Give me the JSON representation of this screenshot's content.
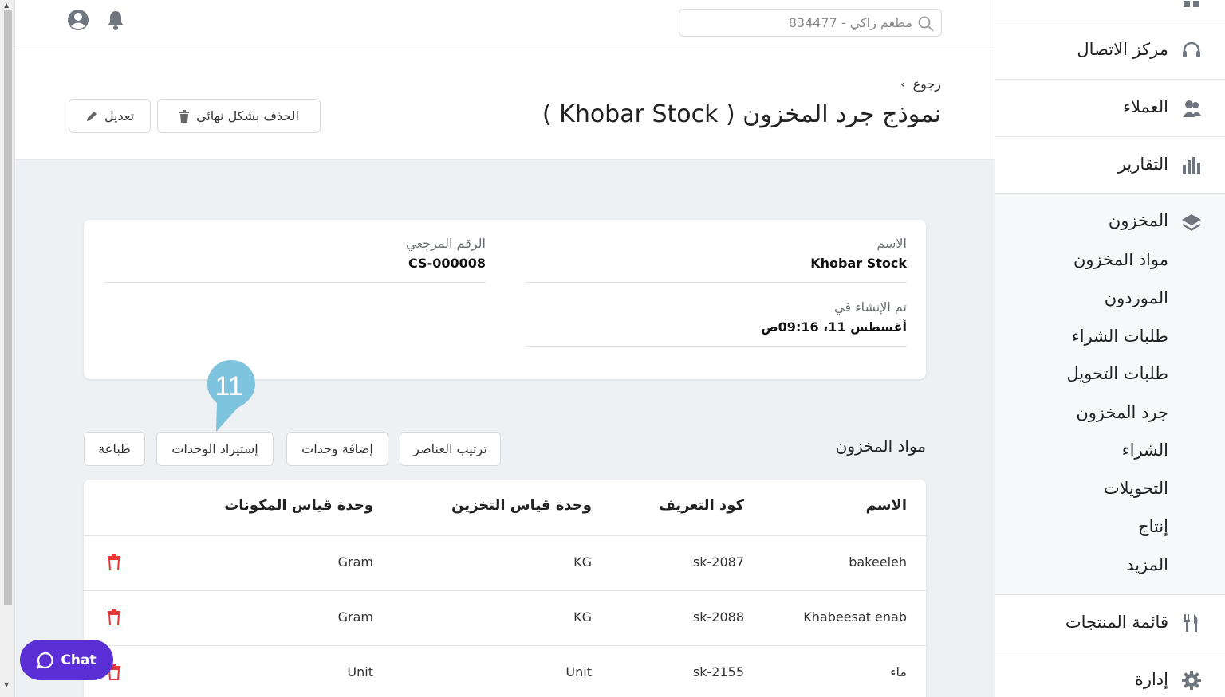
{
  "topbar": {
    "search_placeholder": "مطعم زاكي - 834477"
  },
  "header": {
    "back_label": "رجوع",
    "title": "نموذج جرد المخزون ( Khobar Stock )",
    "delete_label": "الحذف بشكل نهائي",
    "edit_label": "تعديل"
  },
  "details": {
    "name_label": "الاسم",
    "name_value": "Khobar Stock",
    "ref_label": "الرقم المرجعي",
    "ref_value": "CS-000008",
    "created_label": "تم الإنشاء في",
    "created_value": "أغسطس 11، 09:16ص"
  },
  "items_section": {
    "title": "مواد المخزون",
    "buttons": {
      "sort": "ترتيب العناصر",
      "add_units": "إضافة وحدات",
      "import_units": "إستيراد الوحدات",
      "print": "طباعة"
    },
    "columns": {
      "name": "الاسم",
      "sku": "كود التعريف",
      "storage_unit": "وحدة قياس التخزين",
      "ingredient_unit": "وحدة قياس المكونات"
    },
    "rows": [
      {
        "name": "bakeeleh",
        "sku": "sk-2087",
        "storage_unit": "KG",
        "ingredient_unit": "Gram"
      },
      {
        "name": "Khabeesat enab",
        "sku": "sk-2088",
        "storage_unit": "KG",
        "ingredient_unit": "Gram"
      },
      {
        "name": "ماء",
        "sku": "sk-2155",
        "storage_unit": "Unit",
        "ingredient_unit": "Unit"
      }
    ]
  },
  "sidebar": {
    "call_center": "مركز الاتصال",
    "customers": "العملاء",
    "reports": "التقارير",
    "inventory": "المخزون",
    "inventory_sub": [
      "مواد المخزون",
      "الموردون",
      "طلبات الشراء",
      "طلبات التحويل",
      "جرد المخزون",
      "الشراء",
      "التحويلات",
      "إنتاج",
      "المزيد"
    ],
    "menu": "قائمة المنتجات",
    "manage": "إدارة"
  },
  "tour_marker": {
    "number": "11",
    "color": "#7ec3dd"
  },
  "chat": {
    "label": "Chat",
    "color": "#5b2fd6"
  },
  "colors": {
    "danger": "#e53935",
    "background": "#eef1f4"
  }
}
